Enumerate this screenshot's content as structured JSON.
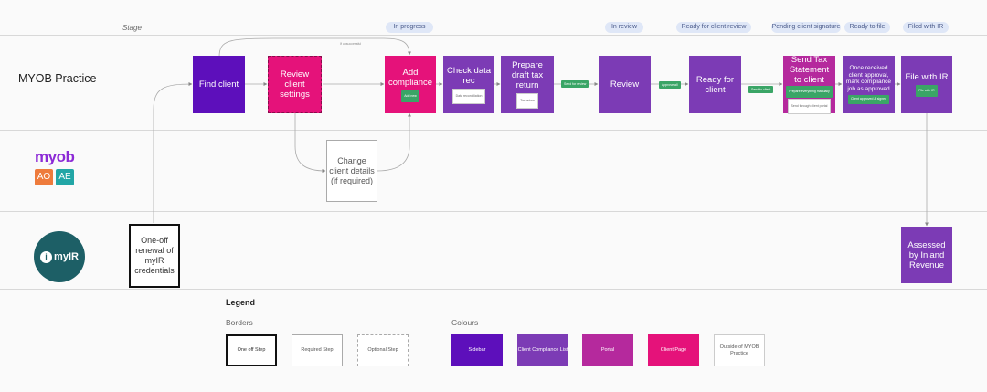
{
  "stage_label": "Stage",
  "stages": [
    {
      "label": "In progress"
    },
    {
      "label": "In review"
    },
    {
      "label": "Ready for client review"
    },
    {
      "label": "Pending client signature"
    },
    {
      "label": "Ready to file"
    },
    {
      "label": "Filed with IR"
    }
  ],
  "lanes": {
    "myob_practice": "MYOB Practice",
    "myob": {
      "wordmark": "myob",
      "ao": "AO",
      "ae": "AE"
    },
    "myir": {
      "label": "myIR"
    }
  },
  "boxes": {
    "find_client": "Find client",
    "review_client_settings": "Review client settings",
    "add_compliance": "Add compliance",
    "add_compliance_chip": "Add new",
    "check_data_rec": "Check data rec",
    "check_data_rec_chip": "Data reconciliation",
    "prepare_draft": "Prepare draft tax return",
    "prepare_draft_chip": "Tax return",
    "review": "Review",
    "ready_for_client": "Ready for client",
    "send_tax_statement": "Send Tax Statement to client",
    "send_tax_statement_chip1": "Prepare everything manually",
    "send_tax_statement_chip2": "Send through client portal",
    "once_received": "Once received client approval, mark compliance job as approved",
    "once_received_chip": "Client approved & signed",
    "file_with_ir": "File with IR",
    "file_with_ir_chip": "File with IR",
    "change_client_details": "Change client details (if required)",
    "one_off_renewal": "One-off renewal of myIR credentials",
    "assessed": "Assessed by Inland Revenue"
  },
  "connector_chips": {
    "send_for_review": "Send for review",
    "approve_all": "Approve all",
    "send_to_client": "Send to client",
    "if_unsuccessful": "If unsuccessful"
  },
  "legend": {
    "title": "Legend",
    "borders_title": "Borders",
    "colours_title": "Colours",
    "borders": [
      "One off Step",
      "Required Step",
      "Optional Step"
    ],
    "colours": [
      "Sidebar",
      "Client Compliance List",
      "Portal",
      "Client Page",
      "Outside of MYOB Practice"
    ]
  },
  "colors": {
    "sidebar": "#5d0fbb",
    "client_compliance_list": "#7c3bb5",
    "portal": "#b5299d",
    "client_page": "#e5127a",
    "status_green": "#3aa566",
    "myir_teal": "#1d5f66"
  }
}
